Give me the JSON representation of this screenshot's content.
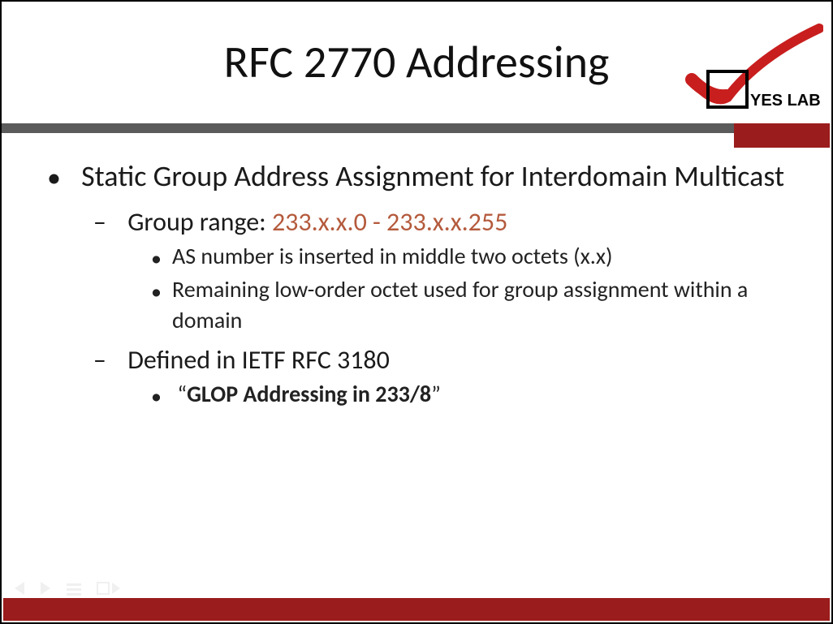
{
  "title": "RFC 2770 Addressing",
  "logo": {
    "label": "YES LAB"
  },
  "bullets": {
    "main": "Static Group Address Assignment for Interdomain Multicast",
    "range_prefix": "Group range: ",
    "range_value": "233.x.x.0 - 233.x.x.255",
    "sub_a": "AS number is inserted in middle two octets (x.x)",
    "sub_b": "Remaining low-order octet used for group assignment within a domain",
    "defined": "Defined in IETF RFC 3180",
    "glop_open": "“",
    "glop_text": "GLOP Addressing in 233/8",
    "glop_close": "”"
  },
  "colors": {
    "accent_red": "#9b1c1c",
    "gray_bar": "#5b5b5b",
    "range_color": "#b45a3c"
  }
}
